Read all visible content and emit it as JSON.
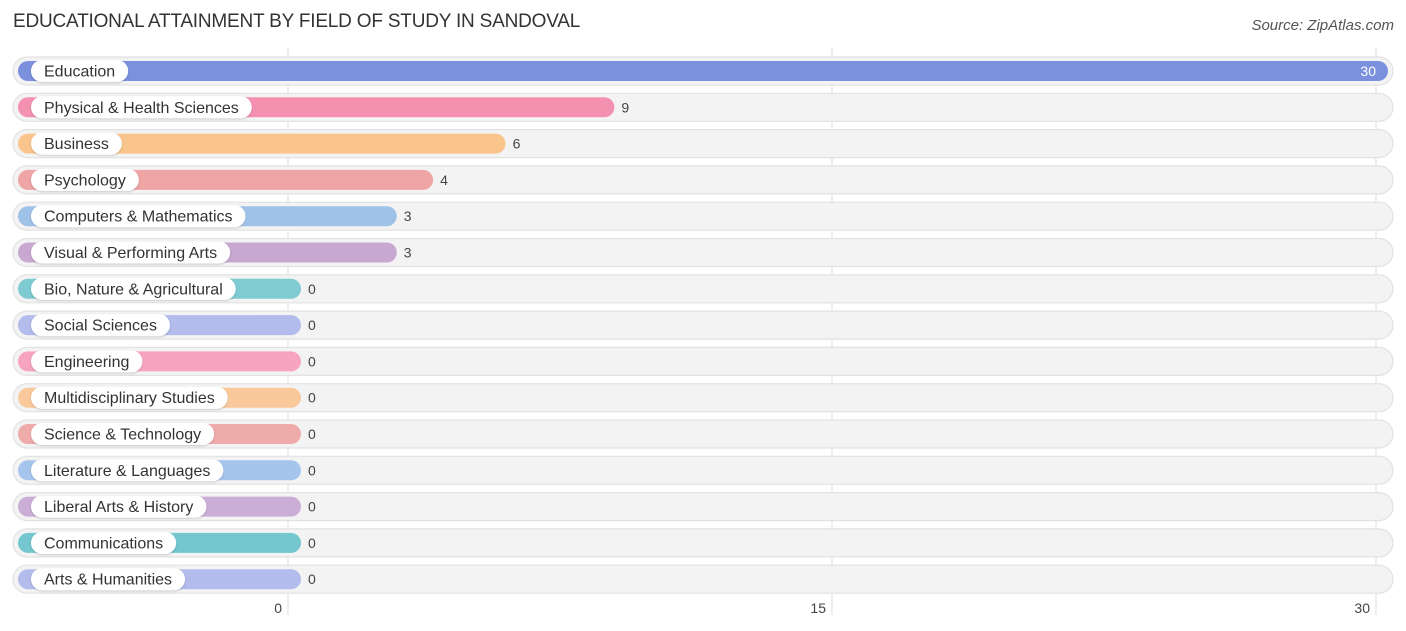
{
  "header": {
    "title": "EDUCATIONAL ATTAINMENT BY FIELD OF STUDY IN SANDOVAL",
    "source": "Source: ZipAtlas.com"
  },
  "chart_data": {
    "type": "bar",
    "orientation": "horizontal",
    "title": "EDUCATIONAL ATTAINMENT BY FIELD OF STUDY IN SANDOVAL",
    "xlabel": "",
    "ylabel": "",
    "xlim": [
      0,
      30
    ],
    "ticks": [
      0,
      15,
      30
    ],
    "tick_labels": [
      "0",
      "15",
      "30"
    ],
    "grid": true,
    "categories": [
      "Education",
      "Physical & Health Sciences",
      "Business",
      "Psychology",
      "Computers & Mathematics",
      "Visual & Performing Arts",
      "Bio, Nature & Agricultural",
      "Social Sciences",
      "Engineering",
      "Multidisciplinary Studies",
      "Science & Technology",
      "Literature & Languages",
      "Liberal Arts & History",
      "Communications",
      "Arts & Humanities"
    ],
    "values": [
      30,
      9,
      6,
      4,
      3,
      3,
      0,
      0,
      0,
      0,
      0,
      0,
      0,
      0,
      0
    ],
    "value_labels": [
      "30",
      "9",
      "6",
      "4",
      "3",
      "3",
      "0",
      "0",
      "0",
      "0",
      "0",
      "0",
      "0",
      "0",
      "0"
    ],
    "colors": [
      "#7b91de",
      "#f591b0",
      "#f9c58d",
      "#efa5a5",
      "#9fc2e8",
      "#c8a8d0",
      "#7ecbd2",
      "#b3bcec",
      "#f7a4c0",
      "#f9c99b",
      "#efaaaa",
      "#a6c5ec",
      "#cbaed6",
      "#74c7cf",
      "#b3bcec"
    ]
  }
}
